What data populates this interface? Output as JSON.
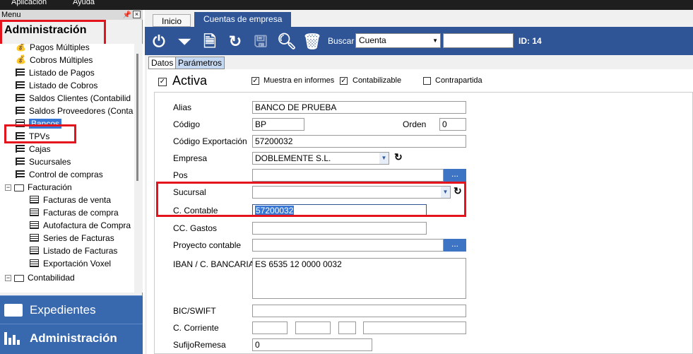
{
  "menubar": {
    "items": [
      "Aplicación",
      "Ayuda"
    ]
  },
  "sidebar": {
    "header_label": "Menu",
    "title": "Administración",
    "tree": [
      {
        "label": "Pagos Múltiples",
        "icon": "money-icon"
      },
      {
        "label": "Cobros Múltiples",
        "icon": "money-icon"
      },
      {
        "label": "Listado de Pagos",
        "icon": "list-icon"
      },
      {
        "label": "Listado de Cobros",
        "icon": "list-icon"
      },
      {
        "label": "Saldos Clientes (Contabilid",
        "icon": "list-icon"
      },
      {
        "label": "Saldos Proveedores (Conta",
        "icon": "list-icon"
      },
      {
        "label": "Bancos",
        "icon": "card-icon"
      },
      {
        "label": "TPVs",
        "icon": "list-icon"
      },
      {
        "label": "Cajas",
        "icon": "list-icon"
      },
      {
        "label": "Sucursales",
        "icon": "list-icon"
      },
      {
        "label": "Control de compras",
        "icon": "list-icon"
      },
      {
        "label": "Facturación",
        "icon": "folder-icon"
      },
      {
        "label": "Facturas de venta",
        "icon": "doc-icon"
      },
      {
        "label": "Facturas de compra",
        "icon": "doc-icon"
      },
      {
        "label": "Autofactura de Compra",
        "icon": "doc-icon"
      },
      {
        "label": "Series de Facturas",
        "icon": "doc-icon"
      },
      {
        "label": "Listado de Facturas",
        "icon": "doc-icon"
      },
      {
        "label": "Exportación Voxel",
        "icon": "doc-icon"
      },
      {
        "label": "Contabilidad",
        "icon": "folder-icon"
      }
    ],
    "nav": {
      "expedientes": "Expedientes",
      "administracion": "Administración"
    }
  },
  "tabs": {
    "inicio": "Inicio",
    "cuentas": "Cuentas de empresa"
  },
  "toolbar": {
    "buscar_label": "Buscar",
    "buscar_field": "Cuenta",
    "search_value": "",
    "id_label": "ID: 14"
  },
  "subtabs": {
    "datos": "Datos",
    "parametros": "Parámetros"
  },
  "form": {
    "activa": "Activa",
    "muestra": "Muestra en informes",
    "contabilizable": "Contabilizable",
    "contrapartida": "Contrapartida",
    "alias_label": "Alias",
    "alias": "BANCO DE PRUEBA",
    "codigo_label": "Código",
    "codigo": "BP",
    "orden_label": "Orden",
    "orden": "0",
    "codexp_label": "Código Exportación",
    "codexp": "57200032",
    "empresa_label": "Empresa",
    "empresa": "DOBLEMENTE S.L.",
    "pos_label": "Pos",
    "pos": "",
    "sucursal_label": "Sucursal",
    "sucursal": "",
    "ccontable_label": "C. Contable",
    "ccontable": "57200032",
    "ccgastos_label": "CC. Gastos",
    "ccgastos": "",
    "proyecto_label": "Proyecto contable",
    "proyecto": "",
    "iban_label": "IBAN / C. BANCARIA",
    "iban": "ES 6535 12 0000 0032",
    "bic_label": "BIC/SWIFT",
    "bic": "",
    "ccorriente_label": "C. Corriente",
    "sufijo_label": "SufijoRemesa",
    "sufijo": "0",
    "dots": "..."
  },
  "colors": {
    "accent": "#2f5597",
    "highlight": "#e5141c",
    "selection": "#3878d4"
  }
}
